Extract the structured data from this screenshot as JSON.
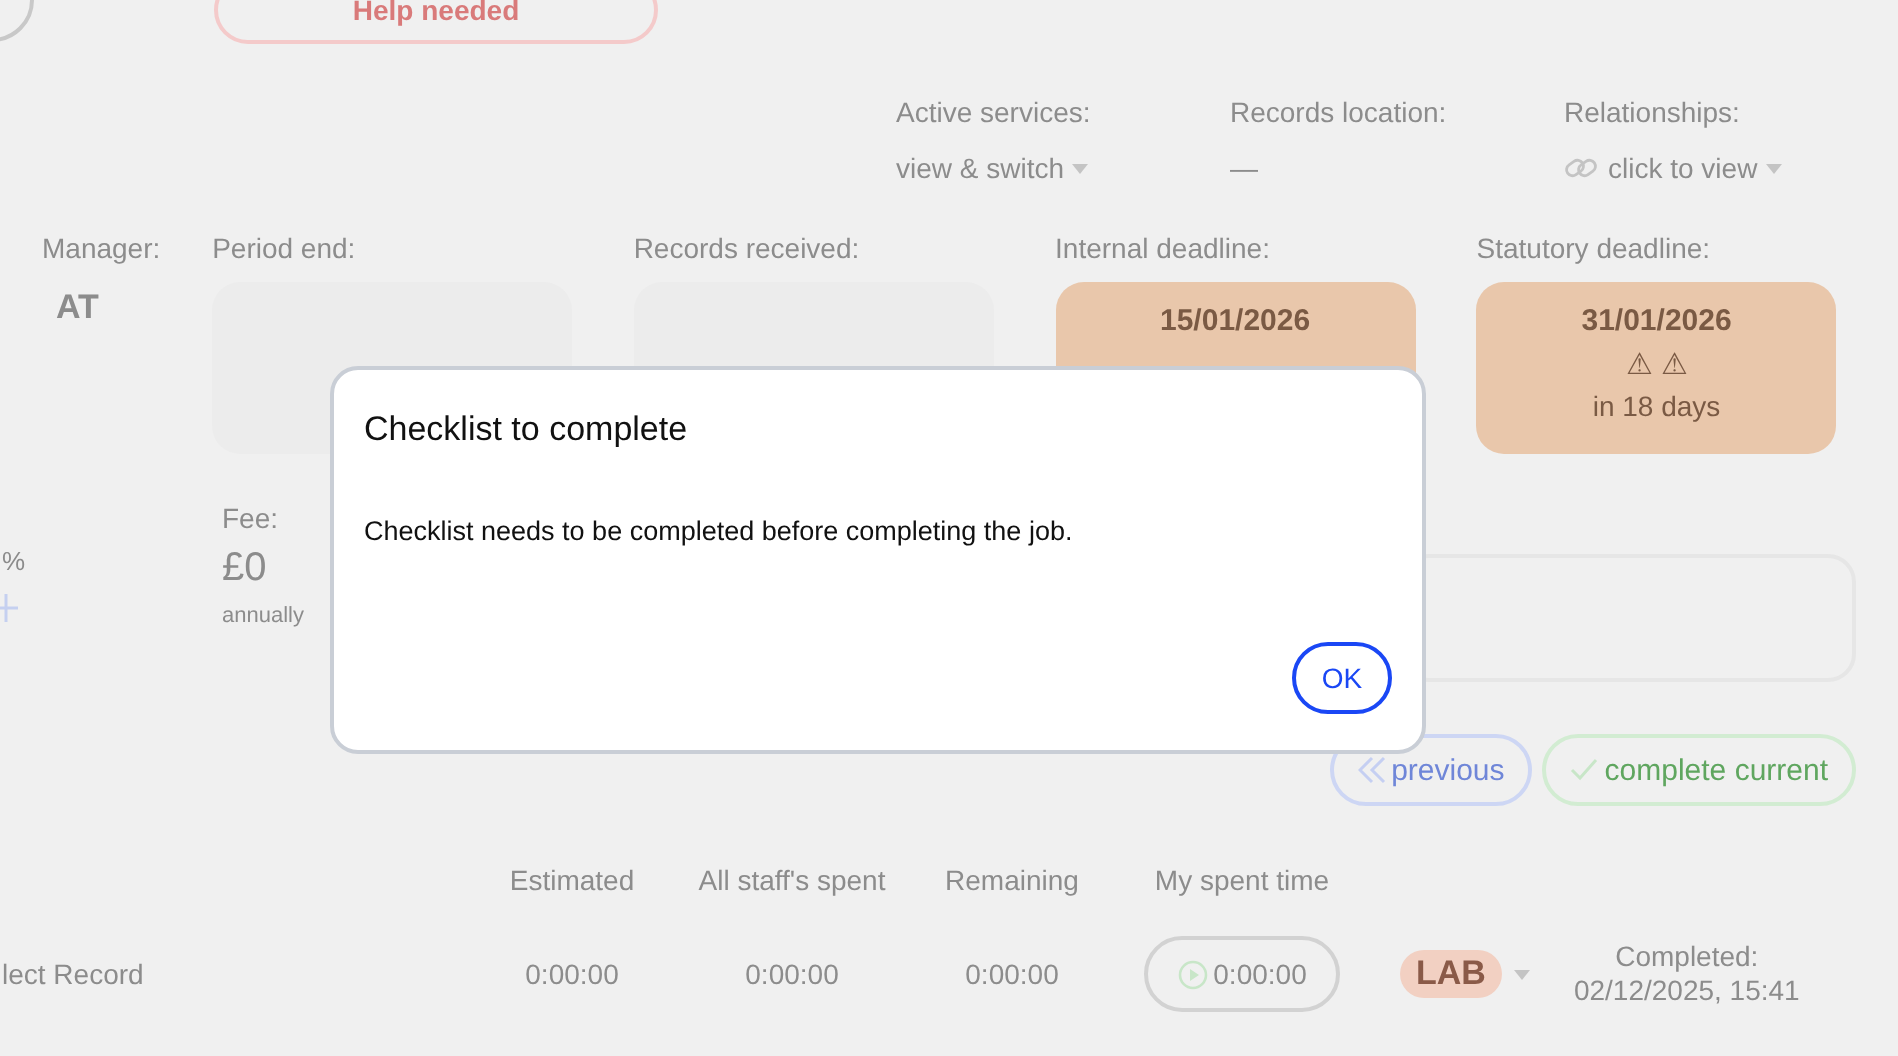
{
  "top": {
    "help_button": "Help needed"
  },
  "info": [
    {
      "label": "Active services:",
      "value": "view & switch",
      "kind": "dropdown"
    },
    {
      "label": "Records location:",
      "value": "—",
      "kind": "text"
    },
    {
      "label": "Relationships:",
      "value": "click to view",
      "kind": "link-dropdown"
    }
  ],
  "manager": {
    "label": "Manager:",
    "value": "AT"
  },
  "dates": [
    {
      "label": "Period end:",
      "kind": "empty"
    },
    {
      "label": "Records received:",
      "kind": "empty"
    },
    {
      "label": "Internal deadline:",
      "kind": "deadline",
      "date": "15/01/2026"
    },
    {
      "label": "Statutory deadline:",
      "kind": "deadline",
      "date": "31/01/2026",
      "warning": "⚠ ⚠",
      "due": "in 18 days"
    }
  ],
  "left_fragments": {
    "percent": "%"
  },
  "fee": {
    "label": "Fee:",
    "value": "£0",
    "period": "annually"
  },
  "nav_buttons": [
    {
      "label": "previous",
      "kind": "previous"
    },
    {
      "label": "complete current",
      "kind": "complete"
    }
  ],
  "table": {
    "columns": [
      "Estimated",
      "All staff's spent",
      "Remaining",
      "My spent time"
    ],
    "rows": [
      {
        "name": "lect Record",
        "estimated": "0:00:00",
        "spent": "0:00:00",
        "remaining": "0:00:00",
        "my_time": "0:00:00",
        "assignee": "LAB",
        "color": "#f2d0c2",
        "status_label": "Completed:",
        "status_date": "02/12/2025, 15:41"
      }
    ]
  },
  "modal": {
    "title": "Checklist to complete",
    "message": "Checklist needs to be completed before completing the job.",
    "button": "OK"
  }
}
